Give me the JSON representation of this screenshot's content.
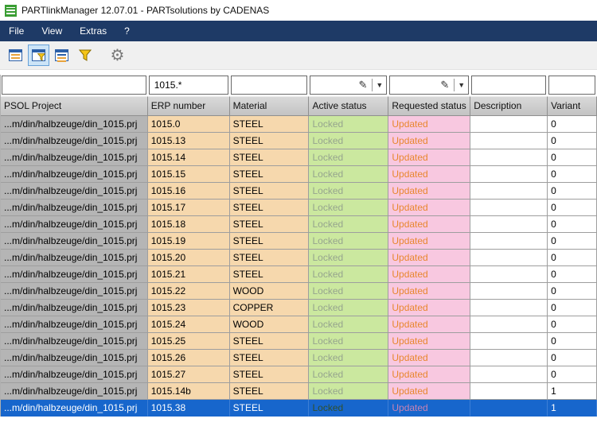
{
  "window": {
    "title": "PARTlinkManager 12.07.01 - PARTsolutions by CADENAS"
  },
  "menu": {
    "items": [
      "File",
      "View",
      "Extras",
      "?"
    ]
  },
  "toolbar": {
    "icons": [
      "link-window-icon",
      "filter-window-icon",
      "table-window-icon",
      "filter-icon",
      "gear-icon"
    ],
    "pressed_index": 1
  },
  "colors": {
    "menu_bg": "#1e3a66",
    "project_cell": "#b5b5b5",
    "erp_cell": "#f6d8ad",
    "active_cell": "#cbe89f",
    "requested_cell": "#f8c8e0",
    "active_text": "#96a48e",
    "requested_text": "#e8872e",
    "selected_row": "#1766cc",
    "app_icon_green": "#3a9e33"
  },
  "table": {
    "columns": [
      "PSOL Project",
      "ERP number",
      "Material",
      "Active status",
      "Requested status",
      "Description",
      "Variant"
    ],
    "filters": {
      "psol_project": "",
      "erp_number": "1015.*",
      "material": "",
      "active_status_icons": [
        "pencil-icon",
        "dropdown-arrow-icon"
      ],
      "requested_status_icons": [
        "pencil-icon",
        "dropdown-arrow-icon"
      ],
      "description": "",
      "variant": ""
    },
    "selected_row_index": 17,
    "rows": [
      {
        "project": "...m/din/halbzeuge/din_1015.prj",
        "erp": "1015.0",
        "material": "STEEL",
        "active": "Locked",
        "requested": "Updated",
        "description": "",
        "variant": "0"
      },
      {
        "project": "...m/din/halbzeuge/din_1015.prj",
        "erp": "1015.13",
        "material": "STEEL",
        "active": "Locked",
        "requested": "Updated",
        "description": "",
        "variant": "0"
      },
      {
        "project": "...m/din/halbzeuge/din_1015.prj",
        "erp": "1015.14",
        "material": "STEEL",
        "active": "Locked",
        "requested": "Updated",
        "description": "",
        "variant": "0"
      },
      {
        "project": "...m/din/halbzeuge/din_1015.prj",
        "erp": "1015.15",
        "material": "STEEL",
        "active": "Locked",
        "requested": "Updated",
        "description": "",
        "variant": "0"
      },
      {
        "project": "...m/din/halbzeuge/din_1015.prj",
        "erp": "1015.16",
        "material": "STEEL",
        "active": "Locked",
        "requested": "Updated",
        "description": "",
        "variant": "0"
      },
      {
        "project": "...m/din/halbzeuge/din_1015.prj",
        "erp": "1015.17",
        "material": "STEEL",
        "active": "Locked",
        "requested": "Updated",
        "description": "",
        "variant": "0"
      },
      {
        "project": "...m/din/halbzeuge/din_1015.prj",
        "erp": "1015.18",
        "material": "STEEL",
        "active": "Locked",
        "requested": "Updated",
        "description": "",
        "variant": "0"
      },
      {
        "project": "...m/din/halbzeuge/din_1015.prj",
        "erp": "1015.19",
        "material": "STEEL",
        "active": "Locked",
        "requested": "Updated",
        "description": "",
        "variant": "0"
      },
      {
        "project": "...m/din/halbzeuge/din_1015.prj",
        "erp": "1015.20",
        "material": "STEEL",
        "active": "Locked",
        "requested": "Updated",
        "description": "",
        "variant": "0"
      },
      {
        "project": "...m/din/halbzeuge/din_1015.prj",
        "erp": "1015.21",
        "material": "STEEL",
        "active": "Locked",
        "requested": "Updated",
        "description": "",
        "variant": "0"
      },
      {
        "project": "...m/din/halbzeuge/din_1015.prj",
        "erp": "1015.22",
        "material": "WOOD",
        "active": "Locked",
        "requested": "Updated",
        "description": "",
        "variant": "0"
      },
      {
        "project": "...m/din/halbzeuge/din_1015.prj",
        "erp": "1015.23",
        "material": "COPPER",
        "active": "Locked",
        "requested": "Updated",
        "description": "",
        "variant": "0"
      },
      {
        "project": "...m/din/halbzeuge/din_1015.prj",
        "erp": "1015.24",
        "material": "WOOD",
        "active": "Locked",
        "requested": "Updated",
        "description": "",
        "variant": "0"
      },
      {
        "project": "...m/din/halbzeuge/din_1015.prj",
        "erp": "1015.25",
        "material": "STEEL",
        "active": "Locked",
        "requested": "Updated",
        "description": "",
        "variant": "0"
      },
      {
        "project": "...m/din/halbzeuge/din_1015.prj",
        "erp": "1015.26",
        "material": "STEEL",
        "active": "Locked",
        "requested": "Updated",
        "description": "",
        "variant": "0"
      },
      {
        "project": "...m/din/halbzeuge/din_1015.prj",
        "erp": "1015.27",
        "material": "STEEL",
        "active": "Locked",
        "requested": "Updated",
        "description": "",
        "variant": "0"
      },
      {
        "project": "...m/din/halbzeuge/din_1015.prj",
        "erp": "1015.14b",
        "material": "STEEL",
        "active": "Locked",
        "requested": "Updated",
        "description": "",
        "variant": "1"
      },
      {
        "project": "...m/din/halbzeuge/din_1015.prj",
        "erp": "1015.38",
        "material": "STEEL",
        "active": "Locked",
        "requested": "Updated",
        "description": "",
        "variant": "1"
      }
    ]
  }
}
